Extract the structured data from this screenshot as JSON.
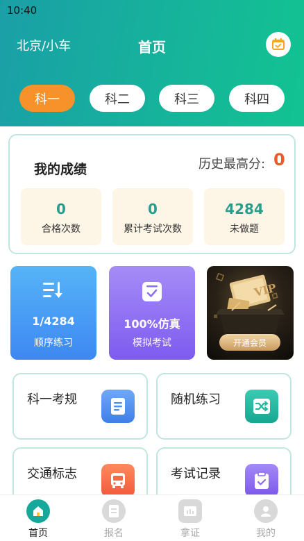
{
  "status_bar": {
    "time": "10:40"
  },
  "header": {
    "city": "北京/小车",
    "title": "首页"
  },
  "tabs": [
    {
      "label": "科一",
      "active": true
    },
    {
      "label": "科二",
      "active": false
    },
    {
      "label": "科三",
      "active": false
    },
    {
      "label": "科四",
      "active": false
    }
  ],
  "score": {
    "title": "我的成绩",
    "best_label": "历史最高分:",
    "best_value": "0",
    "stats": [
      {
        "value": "0",
        "label": "合格次数"
      },
      {
        "value": "0",
        "label": "累计考试次数"
      },
      {
        "value": "4284",
        "label": "未做题"
      }
    ]
  },
  "features": {
    "sequential": {
      "main": "1/4284",
      "sub": "顺序练习"
    },
    "mock": {
      "main": "100%仿真",
      "sub": "模拟考试"
    },
    "vip": {
      "button": "开通会员"
    }
  },
  "tiles": [
    {
      "label": "科一考规",
      "icon": "document-icon",
      "color": "#4a8df0"
    },
    {
      "label": "随机练习",
      "icon": "shuffle-icon",
      "color": "#1fb8a0"
    },
    {
      "label": "交通标志",
      "icon": "bus-icon",
      "color": "#f56a45"
    },
    {
      "label": "考试记录",
      "icon": "clipboard-icon",
      "color": "#8a67f0"
    }
  ],
  "bottom_nav": [
    {
      "label": "首页",
      "active": true
    },
    {
      "label": "报名",
      "active": false
    },
    {
      "label": "拿证",
      "active": false
    },
    {
      "label": "我的",
      "active": false
    }
  ],
  "colors": {
    "header_start": "#1a9fa7",
    "header_end": "#12c391",
    "accent": "#f7922a",
    "teal": "#2a9d8f"
  }
}
